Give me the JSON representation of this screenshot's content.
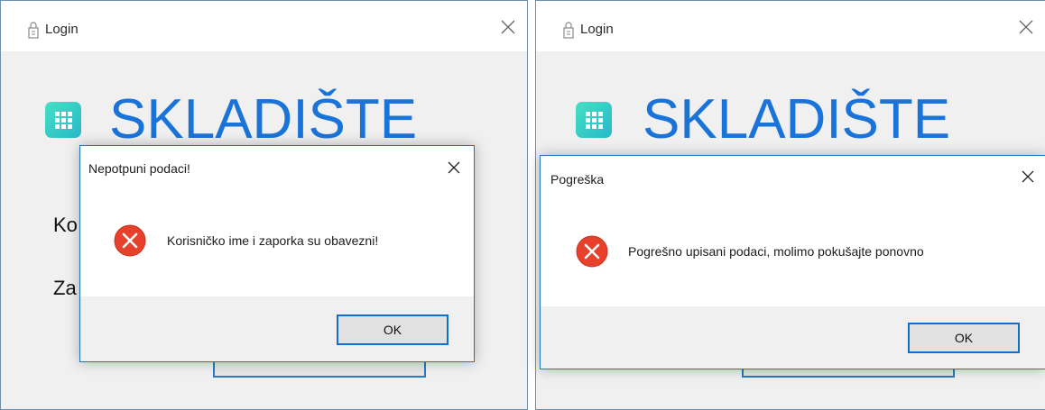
{
  "left_window": {
    "title": "Login",
    "logo_text": "SKLADIŠTE",
    "label_user_partial": "Ko",
    "label_password_partial": "Za"
  },
  "right_window": {
    "title": "Login",
    "logo_text": "SKLADIŠTE"
  },
  "left_dialog": {
    "title": "Nepotpuni podaci!",
    "message": "Korisničko ime i zaporka su obavezni!",
    "ok_label": "OK",
    "icon": "error-icon"
  },
  "right_dialog": {
    "title": "Pogreška",
    "message": "Pogrešno upisani podaci, molimo pokušajte ponovno",
    "ok_label": "OK",
    "icon": "error-icon"
  },
  "colors": {
    "logo_blue": "#1a73d8",
    "error_red": "#e8412b",
    "button_border": "#0f6fd1",
    "logo_tile": "#2fc7c6"
  }
}
